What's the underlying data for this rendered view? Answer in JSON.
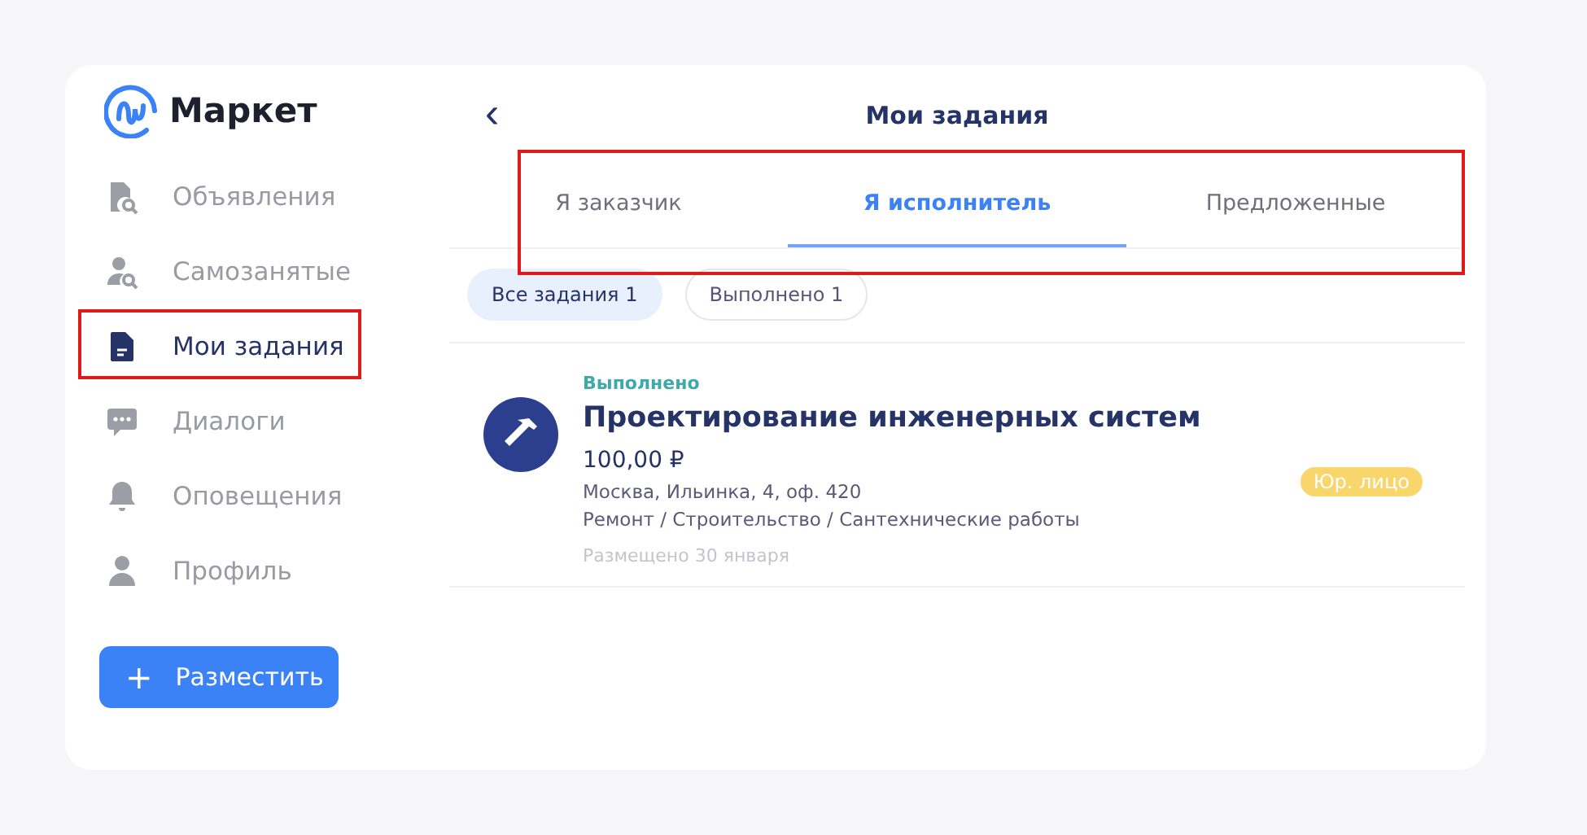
{
  "logo": {
    "text": "Маркет"
  },
  "sidebar": {
    "items": [
      {
        "label": "Объявления",
        "kind": "listing",
        "selected": false,
        "highlighted": false
      },
      {
        "label": "Самозанятые",
        "kind": "person-search",
        "selected": false,
        "highlighted": false
      },
      {
        "label": "Мои задания",
        "kind": "document",
        "selected": true,
        "highlighted": true
      },
      {
        "label": "Диалоги",
        "kind": "chat",
        "selected": false,
        "highlighted": false
      },
      {
        "label": "Оповещения",
        "kind": "bell",
        "selected": false,
        "highlighted": false
      },
      {
        "label": "Профиль",
        "kind": "person",
        "selected": false,
        "highlighted": false
      }
    ],
    "button": {
      "icon": "+",
      "label": "Разместить"
    }
  },
  "header": {
    "back": "‹",
    "title": "Мои задания"
  },
  "tabs": {
    "highlighted": true,
    "items": [
      {
        "label": "Я заказчик",
        "selected": false
      },
      {
        "label": "Я исполнитель",
        "selected": true
      },
      {
        "label": "Предложенные",
        "selected": false
      }
    ]
  },
  "filters": [
    {
      "label": "Все задания 1",
      "selected": true
    },
    {
      "label": "Выполнено 1",
      "selected": false
    }
  ],
  "tasks": [
    {
      "status": "Выполнено",
      "title": "Проектирование инженерных систем",
      "price": "100,00 ₽",
      "address": "Москва, Ильинка, 4, оф. 420",
      "category": "Ремонт / Строительство / Сантехнические работы",
      "posted": "Размещено 30 января",
      "badge": "Юр. лицо"
    }
  ]
}
